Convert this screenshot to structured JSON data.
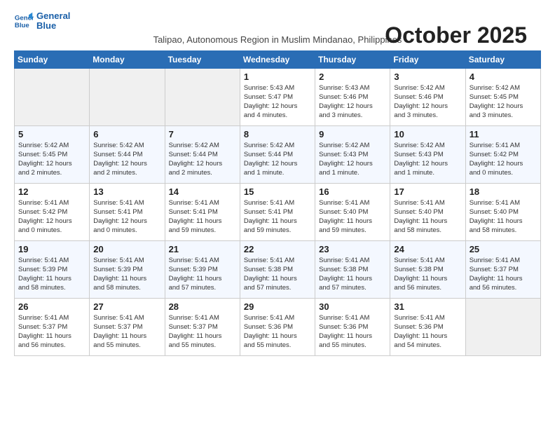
{
  "header": {
    "logo_line1": "General",
    "logo_line2": "Blue",
    "month_year": "October 2025",
    "location": "Talipao, Autonomous Region in Muslim Mindanao, Philippines"
  },
  "weekdays": [
    "Sunday",
    "Monday",
    "Tuesday",
    "Wednesday",
    "Thursday",
    "Friday",
    "Saturday"
  ],
  "weeks": [
    [
      {
        "day": "",
        "info": ""
      },
      {
        "day": "",
        "info": ""
      },
      {
        "day": "",
        "info": ""
      },
      {
        "day": "1",
        "info": "Sunrise: 5:43 AM\nSunset: 5:47 PM\nDaylight: 12 hours\nand 4 minutes."
      },
      {
        "day": "2",
        "info": "Sunrise: 5:43 AM\nSunset: 5:46 PM\nDaylight: 12 hours\nand 3 minutes."
      },
      {
        "day": "3",
        "info": "Sunrise: 5:42 AM\nSunset: 5:46 PM\nDaylight: 12 hours\nand 3 minutes."
      },
      {
        "day": "4",
        "info": "Sunrise: 5:42 AM\nSunset: 5:45 PM\nDaylight: 12 hours\nand 3 minutes."
      }
    ],
    [
      {
        "day": "5",
        "info": "Sunrise: 5:42 AM\nSunset: 5:45 PM\nDaylight: 12 hours\nand 2 minutes."
      },
      {
        "day": "6",
        "info": "Sunrise: 5:42 AM\nSunset: 5:44 PM\nDaylight: 12 hours\nand 2 minutes."
      },
      {
        "day": "7",
        "info": "Sunrise: 5:42 AM\nSunset: 5:44 PM\nDaylight: 12 hours\nand 2 minutes."
      },
      {
        "day": "8",
        "info": "Sunrise: 5:42 AM\nSunset: 5:44 PM\nDaylight: 12 hours\nand 1 minute."
      },
      {
        "day": "9",
        "info": "Sunrise: 5:42 AM\nSunset: 5:43 PM\nDaylight: 12 hours\nand 1 minute."
      },
      {
        "day": "10",
        "info": "Sunrise: 5:42 AM\nSunset: 5:43 PM\nDaylight: 12 hours\nand 1 minute."
      },
      {
        "day": "11",
        "info": "Sunrise: 5:41 AM\nSunset: 5:42 PM\nDaylight: 12 hours\nand 0 minutes."
      }
    ],
    [
      {
        "day": "12",
        "info": "Sunrise: 5:41 AM\nSunset: 5:42 PM\nDaylight: 12 hours\nand 0 minutes."
      },
      {
        "day": "13",
        "info": "Sunrise: 5:41 AM\nSunset: 5:41 PM\nDaylight: 12 hours\nand 0 minutes."
      },
      {
        "day": "14",
        "info": "Sunrise: 5:41 AM\nSunset: 5:41 PM\nDaylight: 11 hours\nand 59 minutes."
      },
      {
        "day": "15",
        "info": "Sunrise: 5:41 AM\nSunset: 5:41 PM\nDaylight: 11 hours\nand 59 minutes."
      },
      {
        "day": "16",
        "info": "Sunrise: 5:41 AM\nSunset: 5:40 PM\nDaylight: 11 hours\nand 59 minutes."
      },
      {
        "day": "17",
        "info": "Sunrise: 5:41 AM\nSunset: 5:40 PM\nDaylight: 11 hours\nand 58 minutes."
      },
      {
        "day": "18",
        "info": "Sunrise: 5:41 AM\nSunset: 5:40 PM\nDaylight: 11 hours\nand 58 minutes."
      }
    ],
    [
      {
        "day": "19",
        "info": "Sunrise: 5:41 AM\nSunset: 5:39 PM\nDaylight: 11 hours\nand 58 minutes."
      },
      {
        "day": "20",
        "info": "Sunrise: 5:41 AM\nSunset: 5:39 PM\nDaylight: 11 hours\nand 58 minutes."
      },
      {
        "day": "21",
        "info": "Sunrise: 5:41 AM\nSunset: 5:39 PM\nDaylight: 11 hours\nand 57 minutes."
      },
      {
        "day": "22",
        "info": "Sunrise: 5:41 AM\nSunset: 5:38 PM\nDaylight: 11 hours\nand 57 minutes."
      },
      {
        "day": "23",
        "info": "Sunrise: 5:41 AM\nSunset: 5:38 PM\nDaylight: 11 hours\nand 57 minutes."
      },
      {
        "day": "24",
        "info": "Sunrise: 5:41 AM\nSunset: 5:38 PM\nDaylight: 11 hours\nand 56 minutes."
      },
      {
        "day": "25",
        "info": "Sunrise: 5:41 AM\nSunset: 5:37 PM\nDaylight: 11 hours\nand 56 minutes."
      }
    ],
    [
      {
        "day": "26",
        "info": "Sunrise: 5:41 AM\nSunset: 5:37 PM\nDaylight: 11 hours\nand 56 minutes."
      },
      {
        "day": "27",
        "info": "Sunrise: 5:41 AM\nSunset: 5:37 PM\nDaylight: 11 hours\nand 55 minutes."
      },
      {
        "day": "28",
        "info": "Sunrise: 5:41 AM\nSunset: 5:37 PM\nDaylight: 11 hours\nand 55 minutes."
      },
      {
        "day": "29",
        "info": "Sunrise: 5:41 AM\nSunset: 5:36 PM\nDaylight: 11 hours\nand 55 minutes."
      },
      {
        "day": "30",
        "info": "Sunrise: 5:41 AM\nSunset: 5:36 PM\nDaylight: 11 hours\nand 55 minutes."
      },
      {
        "day": "31",
        "info": "Sunrise: 5:41 AM\nSunset: 5:36 PM\nDaylight: 11 hours\nand 54 minutes."
      },
      {
        "day": "",
        "info": ""
      }
    ]
  ]
}
